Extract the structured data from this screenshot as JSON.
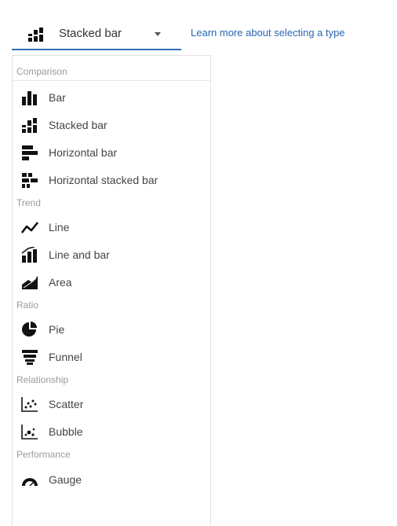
{
  "selector": {
    "selected_label": "Stacked bar",
    "icon": "stacked-bar-icon"
  },
  "learn_link": "Learn more about selecting a type",
  "menu": {
    "categories": {
      "comparison": "Comparison",
      "trend": "Trend",
      "ratio": "Ratio",
      "relationship": "Relationship",
      "performance": "Performance"
    },
    "options": {
      "bar": "Bar",
      "stacked_bar": "Stacked bar",
      "horizontal_bar": "Horizontal bar",
      "horizontal_stacked_bar": "Horizontal stacked bar",
      "line": "Line",
      "line_and_bar": "Line and bar",
      "area": "Area",
      "pie": "Pie",
      "funnel": "Funnel",
      "scatter": "Scatter",
      "bubble": "Bubble",
      "gauge": "Gauge"
    }
  },
  "colors": {
    "icon": "#111111",
    "accent": "#2f6fb3",
    "link": "#2a66b3",
    "category": "#9a9a9a"
  }
}
